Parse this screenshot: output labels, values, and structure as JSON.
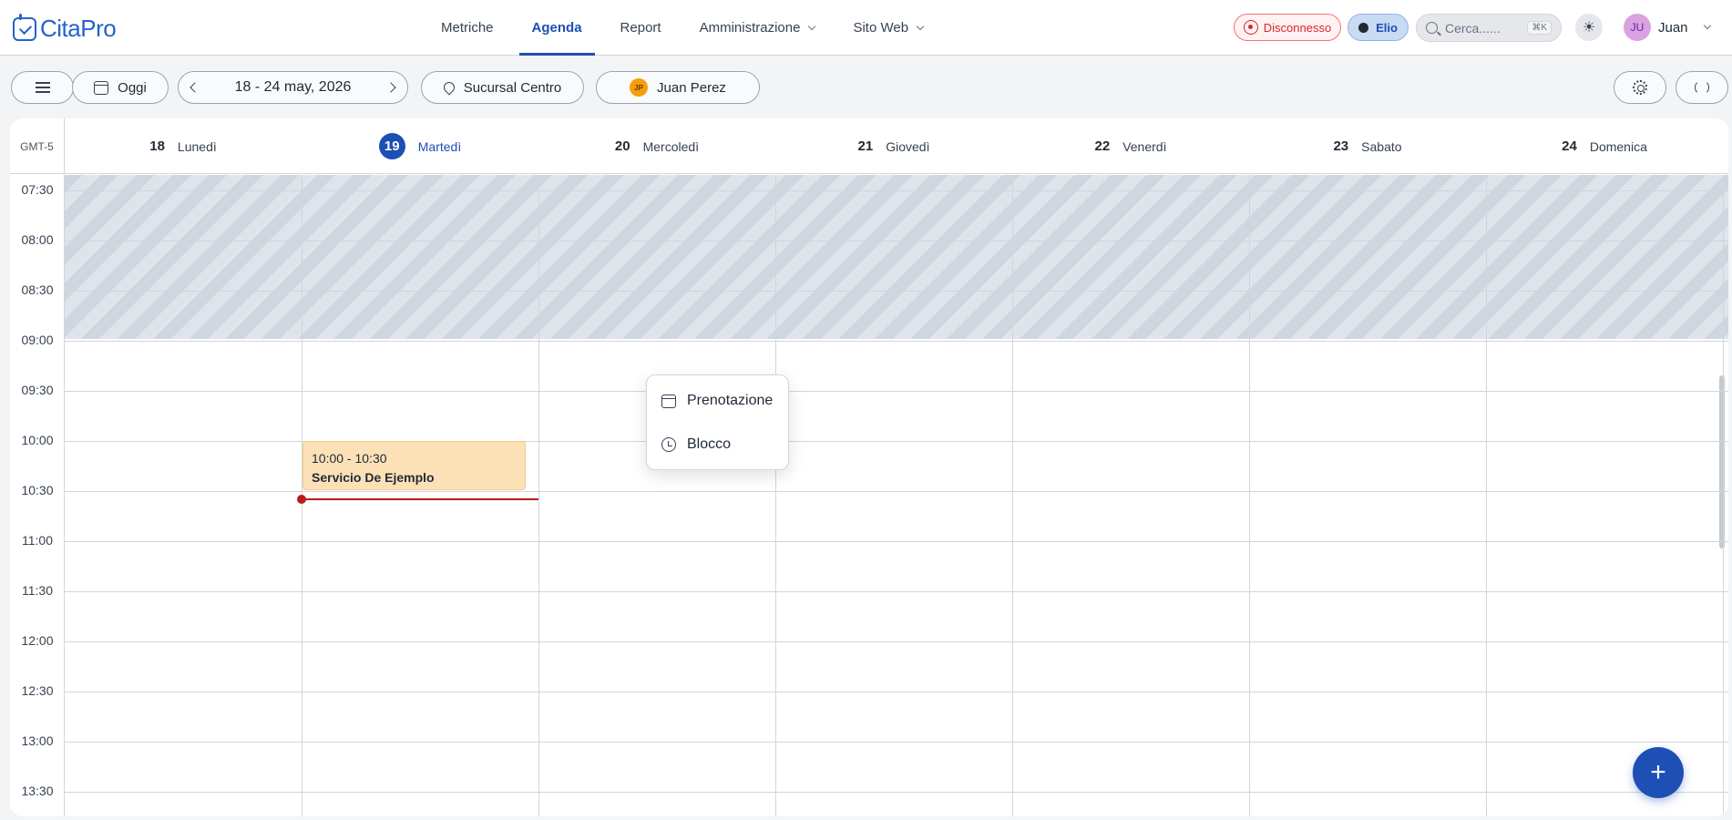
{
  "app": {
    "name": "CitaPro"
  },
  "nav": {
    "items": [
      {
        "label": "Metriche",
        "active": false,
        "dropdown": false
      },
      {
        "label": "Agenda",
        "active": true,
        "dropdown": false
      },
      {
        "label": "Report",
        "active": false,
        "dropdown": false
      },
      {
        "label": "Amministrazione",
        "active": false,
        "dropdown": true
      },
      {
        "label": "Sito Web",
        "active": false,
        "dropdown": true
      }
    ]
  },
  "header": {
    "whatsapp_status": "Disconnesso",
    "assistant": "Elio",
    "search_placeholder": "Cerca......",
    "search_shortcut": "⌘K",
    "user_initials": "JU",
    "user_name": "Juan"
  },
  "toolbar": {
    "today_label": "Oggi",
    "date_range": "18 - 24 may, 2026",
    "branch": "Sucursal Centro",
    "staff_initials": "JP",
    "staff_name": "Juan Perez"
  },
  "calendar": {
    "timezone": "GMT-5",
    "days": [
      {
        "num": "18",
        "name": "Lunedì",
        "today": false
      },
      {
        "num": "19",
        "name": "Martedì",
        "today": true
      },
      {
        "num": "20",
        "name": "Mercoledì",
        "today": false
      },
      {
        "num": "21",
        "name": "Giovedì",
        "today": false
      },
      {
        "num": "22",
        "name": "Venerdì",
        "today": false
      },
      {
        "num": "23",
        "name": "Sabato",
        "today": false
      },
      {
        "num": "24",
        "name": "Domenica",
        "today": false
      }
    ],
    "times": [
      "07:30",
      "08:00",
      "08:30",
      "09:00",
      "09:30",
      "10:00",
      "10:30",
      "11:00",
      "11:30",
      "12:00",
      "12:30",
      "13:00",
      "13:30"
    ],
    "events": [
      {
        "time": "10:00 - 10:30",
        "title": "Servicio De Ejemplo",
        "day_index": 1
      }
    ]
  },
  "context_menu": {
    "items": [
      {
        "label": "Prenotazione",
        "icon": "calendar-icon"
      },
      {
        "label": "Blocco",
        "icon": "clock-icon"
      }
    ]
  },
  "fab": {
    "icon": "plus-icon"
  }
}
